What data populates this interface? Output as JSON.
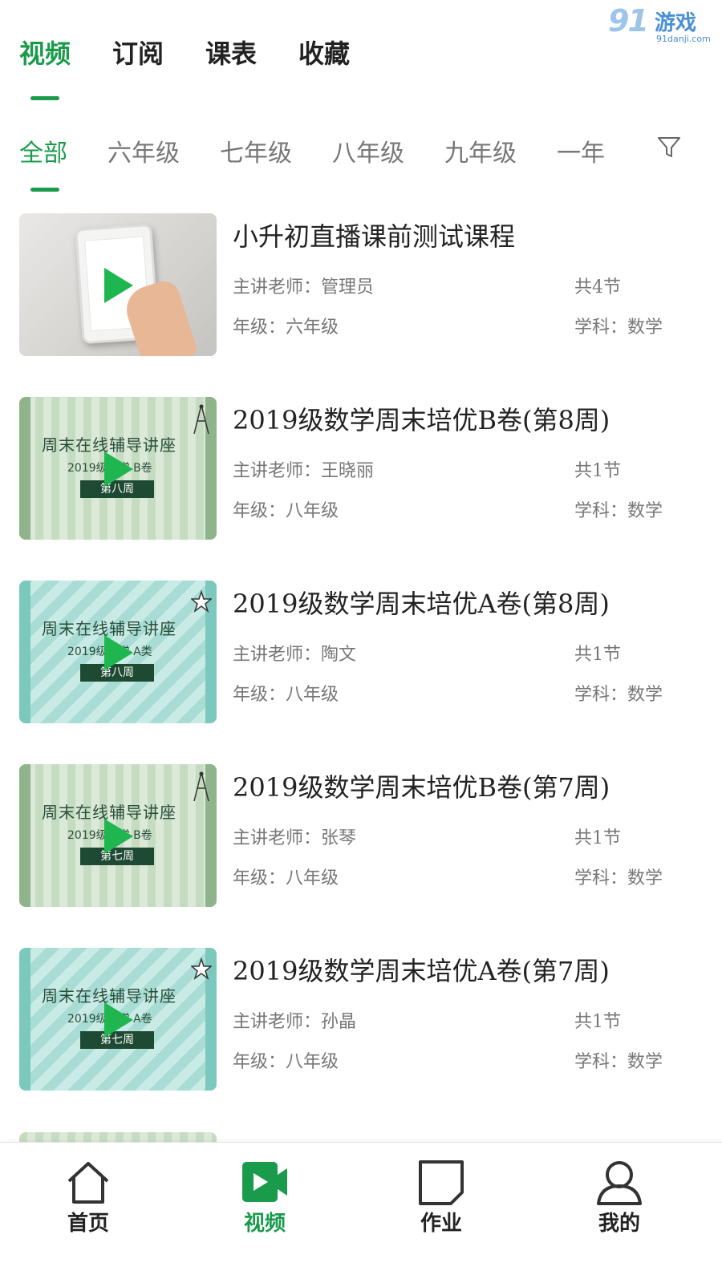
{
  "watermark": {
    "number": "91",
    "text": "游戏",
    "url": "91danji.com"
  },
  "top_tabs": [
    {
      "label": "视频",
      "active": true
    },
    {
      "label": "订阅",
      "active": false
    },
    {
      "label": "课表",
      "active": false
    },
    {
      "label": "收藏",
      "active": false
    }
  ],
  "grade_tabs": [
    {
      "label": "全部",
      "active": true
    },
    {
      "label": "六年级",
      "active": false
    },
    {
      "label": "七年级",
      "active": false
    },
    {
      "label": "八年级",
      "active": false
    },
    {
      "label": "九年级",
      "active": false
    },
    {
      "label": "一年",
      "active": false
    }
  ],
  "filter_icon": "filter-funnel",
  "courses": [
    {
      "title": "小升初直播课前测试课程",
      "teacher": "主讲老师：管理员",
      "lessons": "共4节",
      "grade": "年级：六年级",
      "subject": "学科：数学",
      "thumb_style": "photo"
    },
    {
      "title": "2019级数学周末培优B卷(第8周)",
      "teacher": "主讲老师：王晓丽",
      "lessons": "共1节",
      "grade": "年级：八年级",
      "subject": "学科：数学",
      "thumb_style": "stripes-green",
      "thumb_text": {
        "line1": "周末在线辅导讲座",
        "line2": "2019级数学 B卷",
        "line3": "第八周"
      }
    },
    {
      "title": "2019级数学周末培优A卷(第8周)",
      "teacher": "主讲老师：陶文",
      "lessons": "共1节",
      "grade": "年级：八年级",
      "subject": "学科：数学",
      "thumb_style": "stripes-teal",
      "thumb_text": {
        "line1": "周末在线辅导讲座",
        "line2": "2019级数学 A类",
        "line3": "第八周"
      }
    },
    {
      "title": "2019级数学周末培优B卷(第7周)",
      "teacher": "主讲老师：张琴",
      "lessons": "共1节",
      "grade": "年级：八年级",
      "subject": "学科：数学",
      "thumb_style": "stripes-green",
      "thumb_text": {
        "line1": "周末在线辅导讲座",
        "line2": "2019级数学 B卷",
        "line3": "第七周"
      }
    },
    {
      "title": "2019级数学周末培优A卷(第7周)",
      "teacher": "主讲老师：孙晶",
      "lessons": "共1节",
      "grade": "年级：八年级",
      "subject": "学科：数学",
      "thumb_style": "stripes-teal",
      "thumb_text": {
        "line1": "周末在线辅导讲座",
        "line2": "2019级数学 A卷",
        "line3": "第七周"
      }
    }
  ],
  "bottom_nav": [
    {
      "label": "首页",
      "icon": "home-icon",
      "active": false
    },
    {
      "label": "视频",
      "icon": "video-icon",
      "active": true
    },
    {
      "label": "作业",
      "icon": "homework-icon",
      "active": false
    },
    {
      "label": "我的",
      "icon": "profile-icon",
      "active": false
    }
  ],
  "colors": {
    "accent": "#1a9b4b",
    "play": "#1fb64f",
    "text": "#222222",
    "muted": "#777777"
  }
}
